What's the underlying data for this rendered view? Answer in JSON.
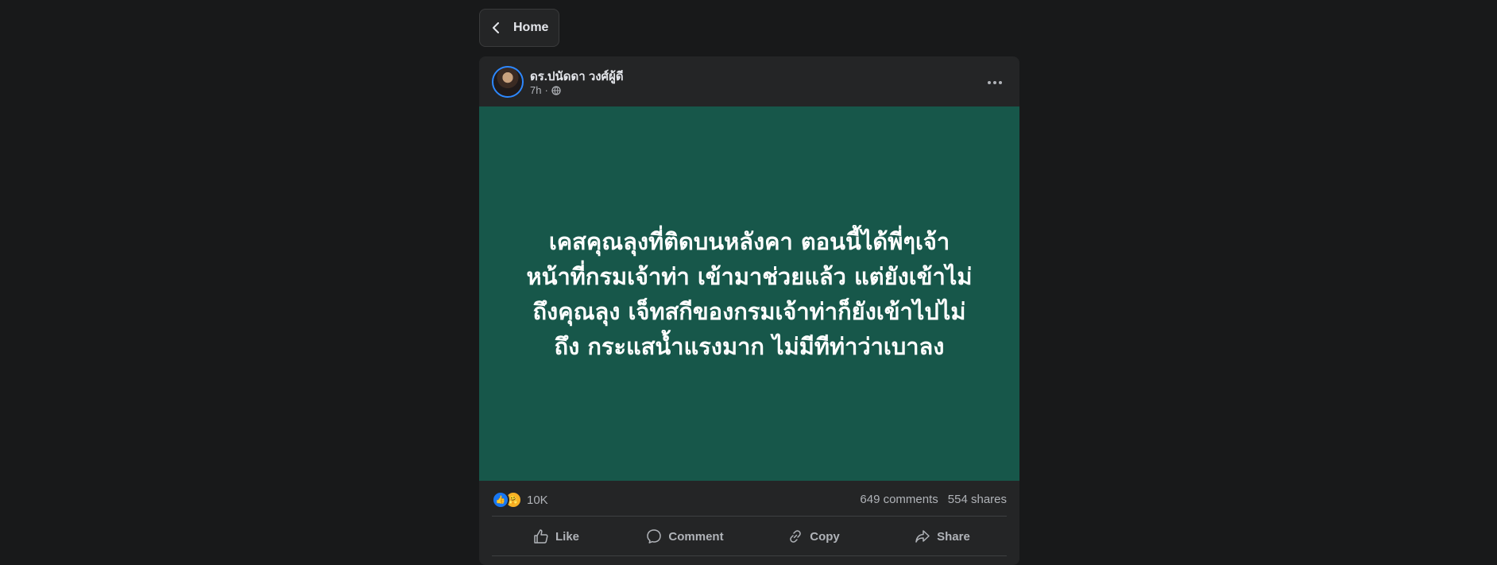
{
  "nav": {
    "home_label": "Home"
  },
  "post": {
    "author": "ดร.ปนัดดา วงศ์ผู้ดี",
    "time": "7h",
    "meta_separator": "·",
    "text_lines": [
      "เคสคุณลุงที่ติดบนหลังคา ตอนนี้ได้พี่ๆเจ้า",
      "หน้าที่กรมเจ้าท่า เข้ามาช่วยแล้ว แต่ยังเข้าไม่",
      "ถึงคุณลุง เจ็ทสกีของกรมเจ้าท่าก็ยังเข้าไปไม่",
      "ถึง กระแสน้ำแรงมาก ไม่มีทีท่าว่าเบาลง"
    ],
    "background_color": "#17574a"
  },
  "stats": {
    "reaction_count": "10K",
    "comments": "649 comments",
    "shares": "554 shares",
    "reaction_icons": [
      "like-icon",
      "care-icon"
    ]
  },
  "actions": {
    "like": "Like",
    "comment": "Comment",
    "copy": "Copy",
    "share": "Share"
  },
  "colors": {
    "page_bg": "#18191a",
    "card_bg": "#242526",
    "accent": "#1877f2",
    "text_primary": "#e4e6eb",
    "text_secondary": "#b0b3b8"
  }
}
